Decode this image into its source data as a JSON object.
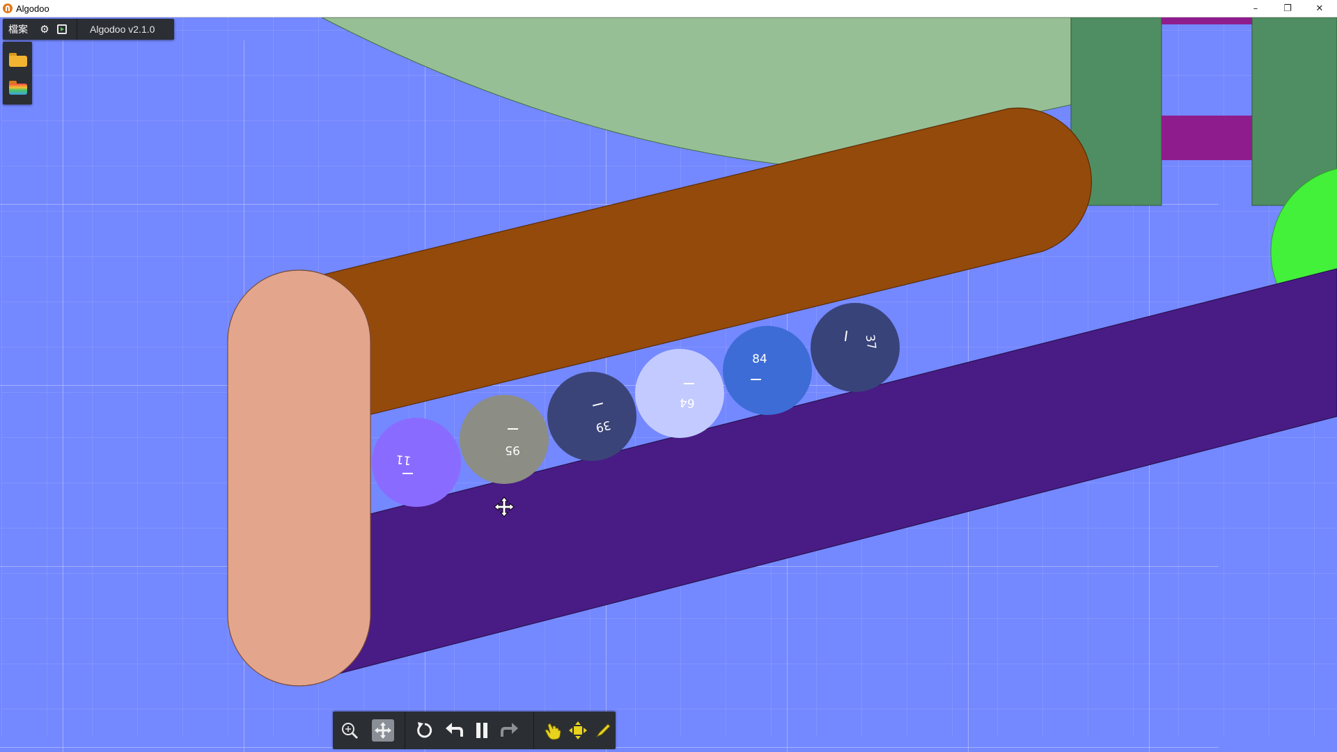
{
  "window": {
    "title": "Algodoo",
    "minimize_glyph": "–",
    "restore_glyph": "❐",
    "close_glyph": "✕"
  },
  "menu": {
    "file_label": "檔案",
    "settings_icon": "gear-icon",
    "play_icon": "play-box-icon",
    "version_label": "Algodoo v2.1.0"
  },
  "sidebar": {
    "items": [
      {
        "icon": "open-folder-icon"
      },
      {
        "icon": "scene-folder-icon"
      }
    ]
  },
  "toolbar": {
    "tools": [
      {
        "icon": "zoom-icon"
      },
      {
        "icon": "move-icon",
        "active": true
      },
      {
        "icon": "reset-icon"
      },
      {
        "icon": "undo-icon"
      },
      {
        "icon": "pause-icon"
      },
      {
        "icon": "redo-icon"
      },
      {
        "icon": "drag-hand-icon"
      },
      {
        "icon": "move-object-icon"
      },
      {
        "icon": "sketch-pen-icon"
      }
    ]
  },
  "scene": {
    "background_color": "#7488ff",
    "balls": [
      {
        "label": "11",
        "color": "#8a6bff"
      },
      {
        "label": "95",
        "color": "#8c8d84"
      },
      {
        "label": "39",
        "color": "#3a4478"
      },
      {
        "label": "64",
        "color": "#c3caff"
      },
      {
        "label": "84",
        "color": "#3d6cd6"
      },
      {
        "label": "37",
        "color": "#38437a"
      }
    ],
    "colors": {
      "pink_capsule": "#e3a68c",
      "brown_ramp": "#944a0b",
      "purple_ramp": "#491c85",
      "green_shape": "#97bf95",
      "dark_green": "#4f8e62",
      "magenta": "#8f1c8d",
      "bright_green": "#43f03a"
    }
  }
}
